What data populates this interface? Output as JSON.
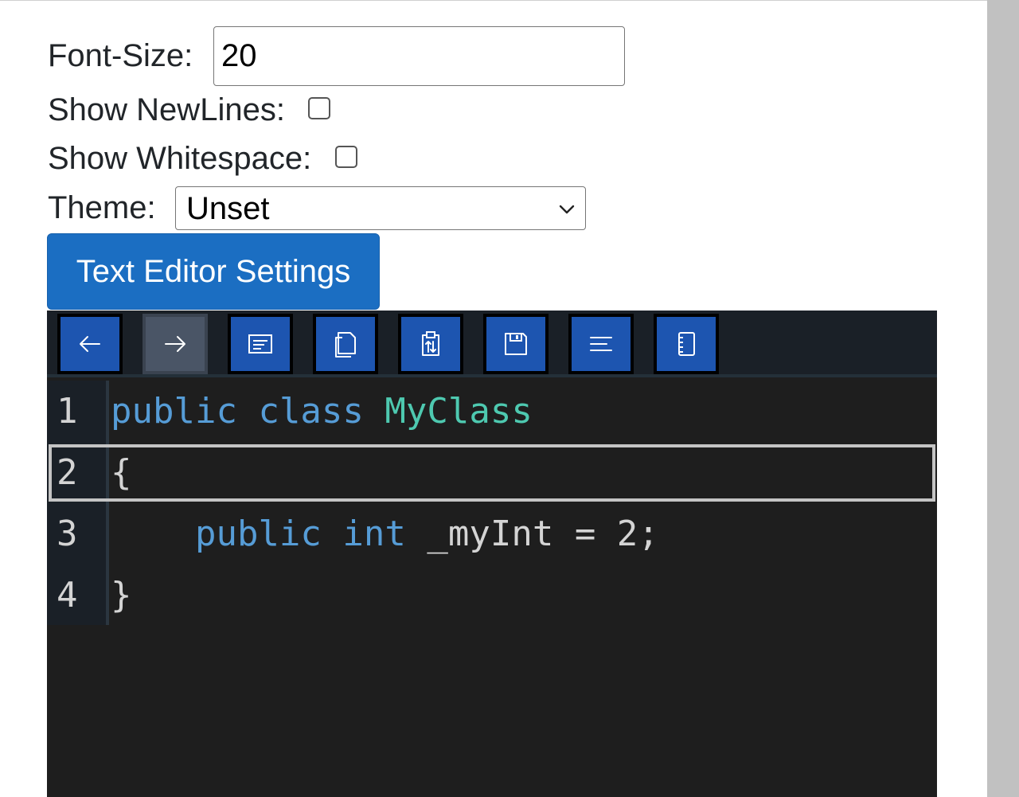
{
  "settings": {
    "font_size_label": "Font-Size:",
    "font_size_value": "20",
    "show_newlines_label": "Show NewLines:",
    "show_newlines_checked": false,
    "show_whitespace_label": "Show Whitespace:",
    "show_whitespace_checked": false,
    "theme_label": "Theme:",
    "theme_value": "Unset",
    "button_label": "Text Editor Settings"
  },
  "toolbar": {
    "buttons": [
      {
        "icon": "arrow-left-icon"
      },
      {
        "icon": "arrow-right-icon",
        "active": true
      },
      {
        "icon": "window-icon"
      },
      {
        "icon": "copy-icon"
      },
      {
        "icon": "clipboard-icon"
      },
      {
        "icon": "save-icon"
      },
      {
        "icon": "align-left-icon"
      },
      {
        "icon": "notebook-icon"
      }
    ]
  },
  "editor": {
    "current_line": 2,
    "line_numbers": [
      "1",
      "2",
      "3",
      "4"
    ],
    "lines": [
      {
        "tokens": [
          {
            "t": "public",
            "c": "kw"
          },
          {
            "t": " ",
            "c": ""
          },
          {
            "t": "class",
            "c": "kw"
          },
          {
            "t": " ",
            "c": ""
          },
          {
            "t": "MyClass",
            "c": "cls"
          }
        ]
      },
      {
        "tokens": [
          {
            "t": "{",
            "c": ""
          }
        ]
      },
      {
        "tokens": [
          {
            "t": "    ",
            "c": ""
          },
          {
            "t": "public",
            "c": "kw"
          },
          {
            "t": " ",
            "c": ""
          },
          {
            "t": "int",
            "c": "kw"
          },
          {
            "t": " _myInt = 2;",
            "c": ""
          }
        ]
      },
      {
        "tokens": [
          {
            "t": "}",
            "c": ""
          }
        ]
      }
    ],
    "colors": {
      "background": "#1e1e1e",
      "keyword": "#569cd6",
      "class": "#4ec9b0",
      "text": "#d4d4d4"
    }
  }
}
